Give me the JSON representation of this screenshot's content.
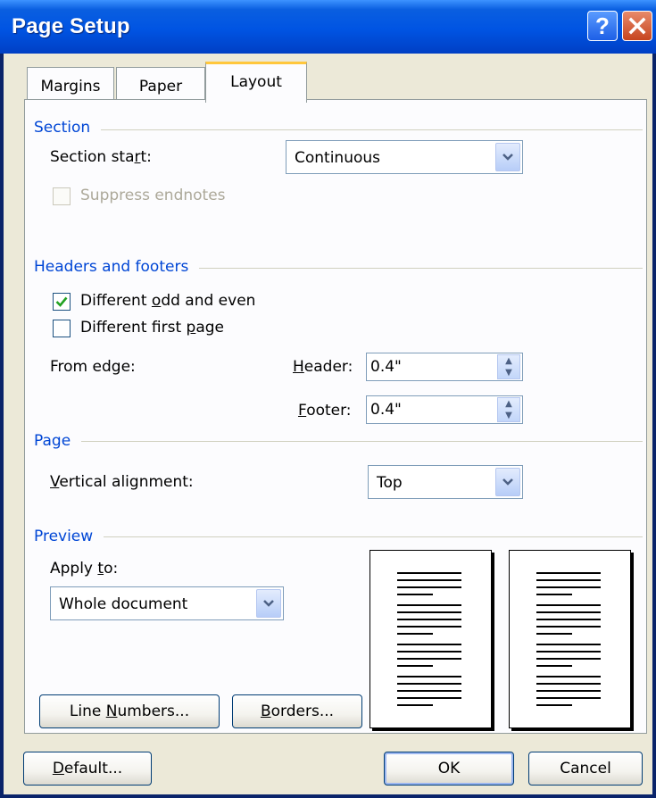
{
  "window": {
    "title": "Page Setup",
    "help_label": "?"
  },
  "tabs": [
    {
      "label": "Margins"
    },
    {
      "label": "Paper"
    },
    {
      "label": "Layout"
    }
  ],
  "section": {
    "heading": "Section",
    "section_start_label_pre": "Section sta",
    "section_start_label_key": "r",
    "section_start_label_post": "t:",
    "section_start_value": "Continuous",
    "suppress_endnotes_label": "Suppress endnotes",
    "suppress_endnotes_checked": false
  },
  "headers_footers": {
    "heading": "Headers and footers",
    "odd_even_pre": "Different ",
    "odd_even_key": "o",
    "odd_even_post": "dd and even",
    "odd_even_checked": true,
    "first_page_pre": "Different first ",
    "first_page_key": "p",
    "first_page_post": "age",
    "first_page_checked": false,
    "from_edge_label": "From edge:",
    "header_key": "H",
    "header_post": "eader:",
    "header_value": "0.4\"",
    "footer_key": "F",
    "footer_post": "ooter:",
    "footer_value": "0.4\""
  },
  "page": {
    "heading": "Page",
    "valign_key": "V",
    "valign_post": "ertical alignment:",
    "valign_value": "Top"
  },
  "preview": {
    "heading": "Preview",
    "apply_pre": "Apply ",
    "apply_key": "t",
    "apply_post": "o:",
    "apply_value": "Whole document"
  },
  "buttons": {
    "line_numbers_pre": "Line ",
    "line_numbers_key": "N",
    "line_numbers_post": "umbers...",
    "borders_key": "B",
    "borders_post": "orders...",
    "default_key": "D",
    "default_post": "efault...",
    "ok": "OK",
    "cancel": "Cancel"
  }
}
